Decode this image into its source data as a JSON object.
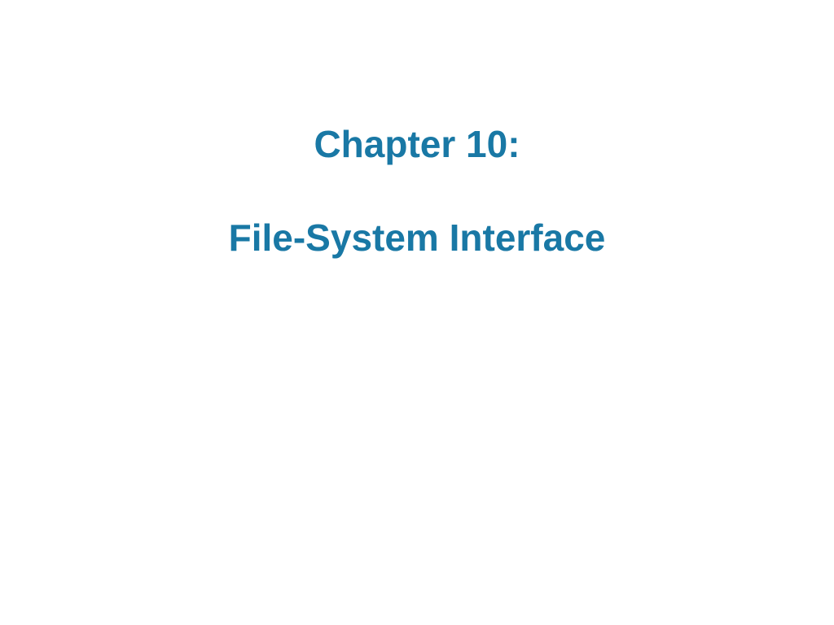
{
  "slide": {
    "chapter_label": "Chapter 10:",
    "subtitle": "File-System Interface"
  }
}
